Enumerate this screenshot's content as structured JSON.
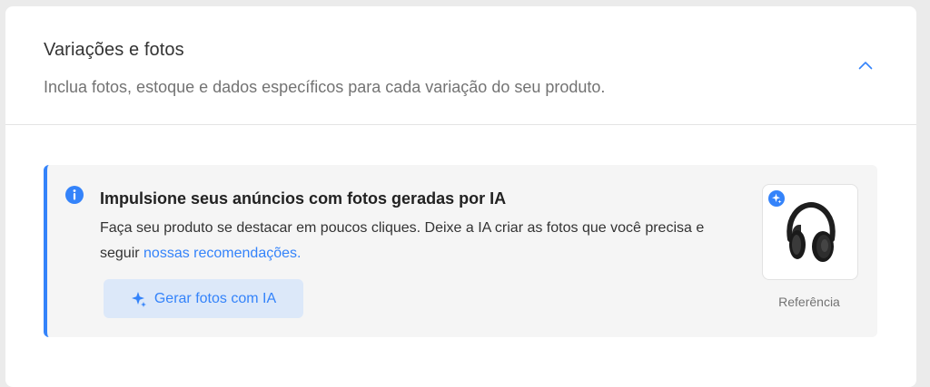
{
  "section": {
    "title": "Variações e fotos",
    "subtitle": "Inclua fotos, estoque e dados específicos para cada variação do seu produto.",
    "collapse_icon": "chevron-up-icon"
  },
  "banner": {
    "icon": "info-icon",
    "title": "Impulsione seus anúncios com fotos geradas por IA",
    "text": "Faça seu produto se destacar em poucos cliques. Deixe a IA criar as fotos que você precisa e seguir",
    "link": "nossas recomendações.",
    "button_label": "Gerar fotos com IA",
    "button_icon": "sparkle-icon",
    "reference_label": "Referência",
    "reference_image": "headphones-image"
  },
  "colors": {
    "accent": "#3483fa",
    "button_bg": "#dce8f9",
    "banner_bg": "#f5f5f5",
    "page_bg": "#ebebeb"
  }
}
